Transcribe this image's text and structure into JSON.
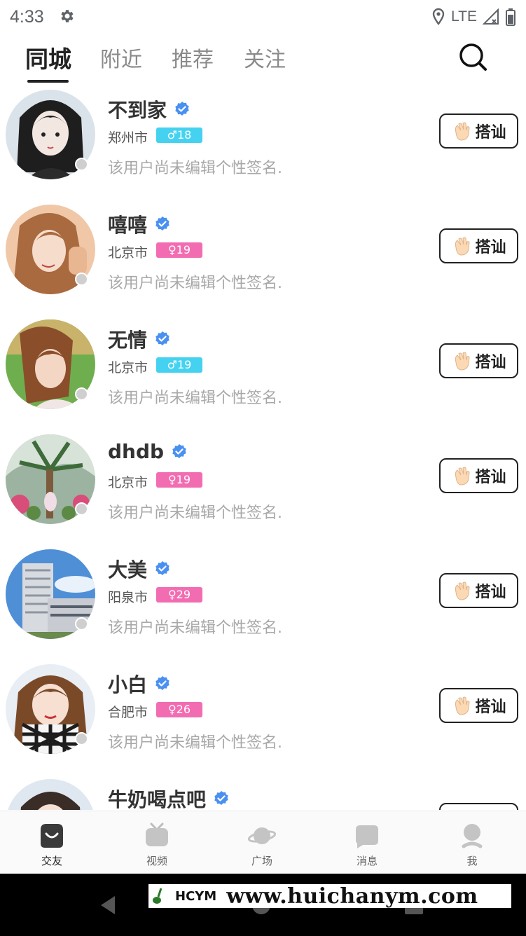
{
  "status_bar": {
    "time": "4:33",
    "network": "LTE",
    "icons": [
      "settings-gear-icon",
      "location-icon",
      "signal-icon",
      "battery-icon"
    ]
  },
  "top_tabs": {
    "items": [
      "同城",
      "附近",
      "推荐",
      "关注"
    ],
    "active_index": 0
  },
  "users": [
    {
      "name": "不到家",
      "city": "郑州市",
      "gender": "male",
      "gender_symbol": "♂",
      "age": "18",
      "signature": "该用户尚未编辑个性签名.",
      "button": "搭讪"
    },
    {
      "name": "嘻嘻",
      "city": "北京市",
      "gender": "female",
      "gender_symbol": "♀",
      "age": "19",
      "signature": "该用户尚未编辑个性签名.",
      "button": "搭讪"
    },
    {
      "name": "无情",
      "city": "北京市",
      "gender": "male",
      "gender_symbol": "♂",
      "age": "19",
      "signature": "该用户尚未编辑个性签名.",
      "button": "搭讪"
    },
    {
      "name": "dhdb",
      "city": "北京市",
      "gender": "female",
      "gender_symbol": "♀",
      "age": "19",
      "signature": "该用户尚未编辑个性签名.",
      "button": "搭讪"
    },
    {
      "name": "大美",
      "city": "阳泉市",
      "gender": "female",
      "gender_symbol": "♀",
      "age": "29",
      "signature": "该用户尚未编辑个性签名.",
      "button": "搭讪"
    },
    {
      "name": "小白",
      "city": "合肥市",
      "gender": "female",
      "gender_symbol": "♀",
      "age": "26",
      "signature": "该用户尚未编辑个性签名.",
      "button": "搭讪"
    },
    {
      "name": "牛奶喝点吧",
      "city": "",
      "gender": "",
      "gender_symbol": "",
      "age": "",
      "signature": "",
      "button": ""
    }
  ],
  "bottom_nav": {
    "items": [
      {
        "label": "交友",
        "icon": "smile-icon"
      },
      {
        "label": "视频",
        "icon": "video-icon"
      },
      {
        "label": "广场",
        "icon": "planet-icon"
      },
      {
        "label": "消息",
        "icon": "message-icon"
      },
      {
        "label": "我",
        "icon": "profile-icon"
      }
    ],
    "active_index": 0
  },
  "watermark": {
    "logo_text": "HCYM",
    "url": "www.huichanym.com"
  },
  "colors": {
    "male_tag": "#45d2f0",
    "female_tag": "#f26cb2",
    "verify_badge": "#4a90f0",
    "active_text": "#222222",
    "inactive_text": "#8a8a8a"
  }
}
